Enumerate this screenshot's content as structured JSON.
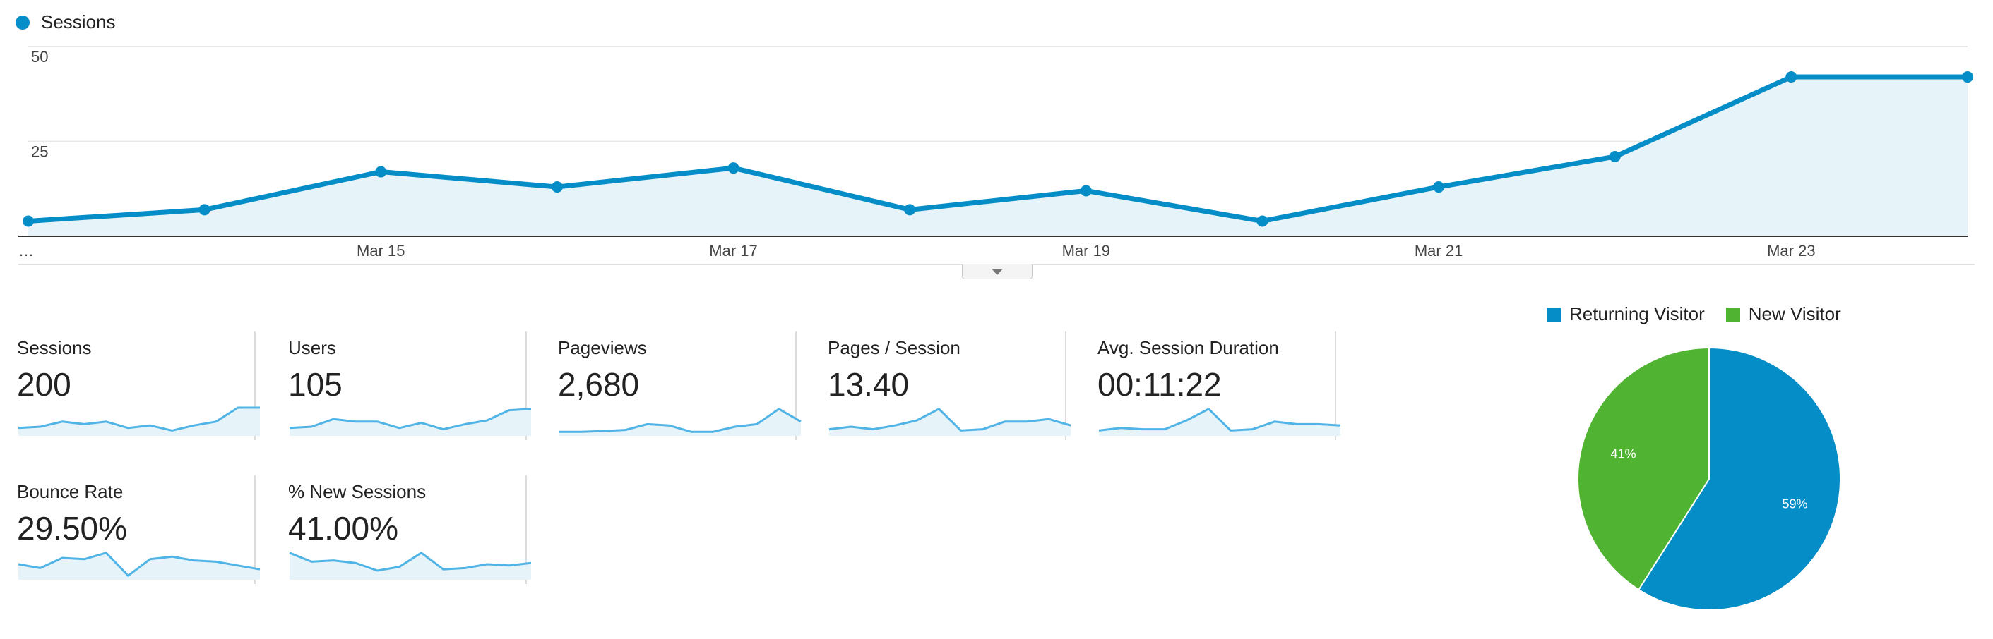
{
  "legend": {
    "series_label": "Sessions",
    "color": "#058dc7"
  },
  "chart_data": {
    "type": "area",
    "series": [
      {
        "name": "Sessions",
        "values": [
          4,
          7,
          17,
          13,
          18,
          7,
          12,
          4,
          13,
          21,
          42,
          42
        ]
      }
    ],
    "x_labels": [
      "…",
      "",
      "Mar 15",
      "",
      "Mar 17",
      "",
      "Mar 19",
      "",
      "Mar 21",
      "",
      "Mar 23",
      ""
    ],
    "y_ticks": [
      "25",
      "50"
    ],
    "ylim": [
      0,
      50
    ],
    "grid": true,
    "line_color": "#058dc7",
    "fill_color": "#e6f3f9"
  },
  "metrics": [
    {
      "label": "Sessions",
      "value": "200",
      "spark": [
        0.2,
        0.25,
        0.45,
        0.35,
        0.45,
        0.2,
        0.3,
        0.1,
        0.3,
        0.45,
        1,
        1
      ]
    },
    {
      "label": "Users",
      "value": "105",
      "spark": [
        0.2,
        0.25,
        0.55,
        0.45,
        0.45,
        0.2,
        0.4,
        0.15,
        0.35,
        0.5,
        0.9,
        0.95
      ]
    },
    {
      "label": "Pageviews",
      "value": "2,680",
      "spark": [
        0.05,
        0.05,
        0.08,
        0.12,
        0.35,
        0.3,
        0.05,
        0.05,
        0.25,
        0.35,
        0.95,
        0.45
      ]
    },
    {
      "label": "Pages / Session",
      "value": "13.40",
      "spark": [
        0.15,
        0.25,
        0.15,
        0.3,
        0.5,
        0.95,
        0.1,
        0.15,
        0.45,
        0.45,
        0.55,
        0.3
      ]
    },
    {
      "label": "Avg. Session Duration",
      "value": "00:11:22",
      "spark": [
        0.1,
        0.2,
        0.15,
        0.15,
        0.5,
        0.95,
        0.1,
        0.15,
        0.45,
        0.35,
        0.35,
        0.3
      ]
    },
    {
      "label": "Bounce Rate",
      "value": "29.50%",
      "spark": [
        0.5,
        0.35,
        0.75,
        0.7,
        0.95,
        0.05,
        0.7,
        0.8,
        0.65,
        0.6,
        0.45,
        0.3
      ]
    },
    {
      "label": "% New Sessions",
      "value": "41.00%",
      "spark": [
        0.95,
        0.6,
        0.65,
        0.55,
        0.25,
        0.4,
        0.95,
        0.3,
        0.35,
        0.5,
        0.45,
        0.55
      ]
    }
  ],
  "spark_color": "#50b4e6",
  "spark_fill": "#e6f3f9",
  "pie": {
    "legend": [
      {
        "label": "Returning Visitor",
        "color": "#058dc7"
      },
      {
        "label": "New Visitor",
        "color": "#50b432"
      }
    ],
    "slices": [
      {
        "label": "59%",
        "value": 59,
        "color": "#058dc7"
      },
      {
        "label": "41%",
        "value": 41,
        "color": "#50b432"
      }
    ]
  }
}
